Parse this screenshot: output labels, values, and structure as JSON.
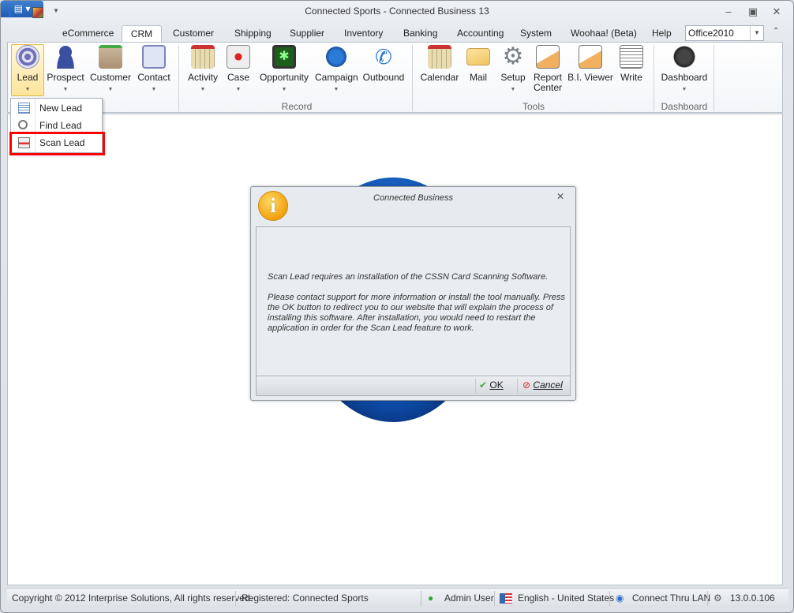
{
  "window": {
    "title": "Connected Sports - Connected Business 13"
  },
  "tabs": [
    "eCommerce",
    "CRM",
    "Customer",
    "Shipping",
    "Supplier",
    "Inventory",
    "Banking",
    "Accounting",
    "System",
    "Woohaa! (Beta)",
    "Help"
  ],
  "active_tab": "CRM",
  "theme_select": {
    "value": "Office2010"
  },
  "ribbon": {
    "buttons": [
      "Lead",
      "Prospect",
      "Customer",
      "Contact",
      "Activity",
      "Case",
      "Opportunity",
      "Campaign",
      "Outbound",
      "Calendar",
      "Mail",
      "Setup",
      "Report Center",
      "B.I. Viewer",
      "Write",
      "Dashboard"
    ],
    "groups": [
      "Record",
      "Tools",
      "Dashboard"
    ]
  },
  "lead_menu": [
    "New Lead",
    "Find Lead",
    "Scan Lead"
  ],
  "dialog": {
    "title": "Connected Business",
    "message1": "Scan Lead requires an installation of the CSSN Card Scanning Software.",
    "message2": "Please contact support for more information or install the tool manually. Press the OK button to redirect you to our website that will explain the process of installing this software. After installation, you would need to restart the application in order for the Scan Lead feature to work.",
    "ok": "OK",
    "cancel": "Cancel"
  },
  "status": {
    "copyright": "Copyright © 2012 Interprise Solutions, All rights reserved.",
    "registered": "Registered: Connected Sports",
    "user": "Admin User",
    "language": "English - United States",
    "connection": "Connect Thru LAN",
    "version": "13.0.0.106"
  }
}
